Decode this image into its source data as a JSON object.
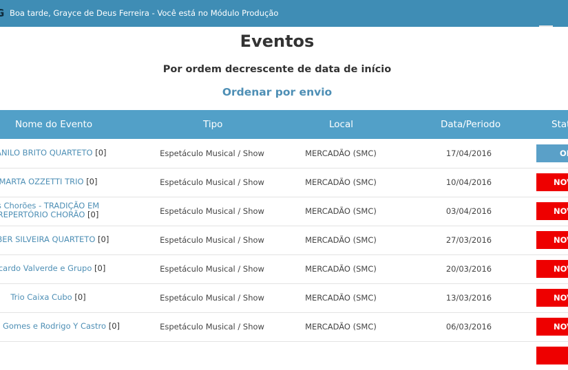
{
  "header": {
    "logo_glyph": "G",
    "greeting": "Boa tarde, Grayce de Deus Ferreira - Você está no Módulo Produção"
  },
  "page": {
    "title": "Eventos",
    "subtitle": "Por ordem decrescente de data de início",
    "sort_link": "Ordenar por envio"
  },
  "table": {
    "columns": [
      "Nome do Evento",
      "Tipo",
      "Local",
      "Data/Periodo",
      "Stat"
    ],
    "rows": [
      {
        "name": "DANILO BRITO QUARTETO",
        "count": "[0]",
        "tipo": "Espetáculo Musical / Show",
        "local": "MERCADÃO (SMC)",
        "date": "17/04/2016",
        "status": "OK",
        "status_type": "ok"
      },
      {
        "name": "MARTA OZZETTI TRIO",
        "count": "[0]",
        "tipo": "Espetáculo Musical / Show",
        "local": "MERCADÃO (SMC)",
        "date": "10/04/2016",
        "status": "NOV",
        "status_type": "new"
      },
      {
        "name": "s Chorões - TRADIÇÃO EM REPERTÓRIO CHORÃO",
        "count": "[0]",
        "tipo": "Espetáculo Musical / Show",
        "local": "MERCADÃO (SMC)",
        "date": "03/04/2016",
        "status": "NOV",
        "status_type": "new"
      },
      {
        "name": "LEBER SILVEIRA QUARTETO",
        "count": "[0]",
        "tipo": "Espetáculo Musical / Show",
        "local": "MERCADÃO (SMC)",
        "date": "27/03/2016",
        "status": "NOV",
        "status_type": "new"
      },
      {
        "name": "Ricardo Valverde e Grupo",
        "count": "[0]",
        "tipo": "Espetáculo Musical / Show",
        "local": "MERCADÃO (SMC)",
        "date": "20/03/2016",
        "status": "NOV",
        "status_type": "new"
      },
      {
        "name": "Trio Caixa Cubo",
        "count": "[0]",
        "tipo": "Espetáculo Musical / Show",
        "local": "MERCADÃO (SMC)",
        "date": "13/03/2016",
        "status": "NOV",
        "status_type": "new"
      },
      {
        "name": "rcules Gomes e Rodrigo Y Castro",
        "count": "[0]",
        "tipo": "Espetáculo Musical / Show",
        "local": "MERCADÃO (SMC)",
        "date": "06/03/2016",
        "status": "NOV",
        "status_type": "new"
      }
    ]
  },
  "colors": {
    "header_bg": "#3f8db5",
    "table_head_bg": "#52a0c8",
    "link": "#4e8fb5",
    "status_new": "#ee0000",
    "status_ok": "#5aa0c8"
  }
}
